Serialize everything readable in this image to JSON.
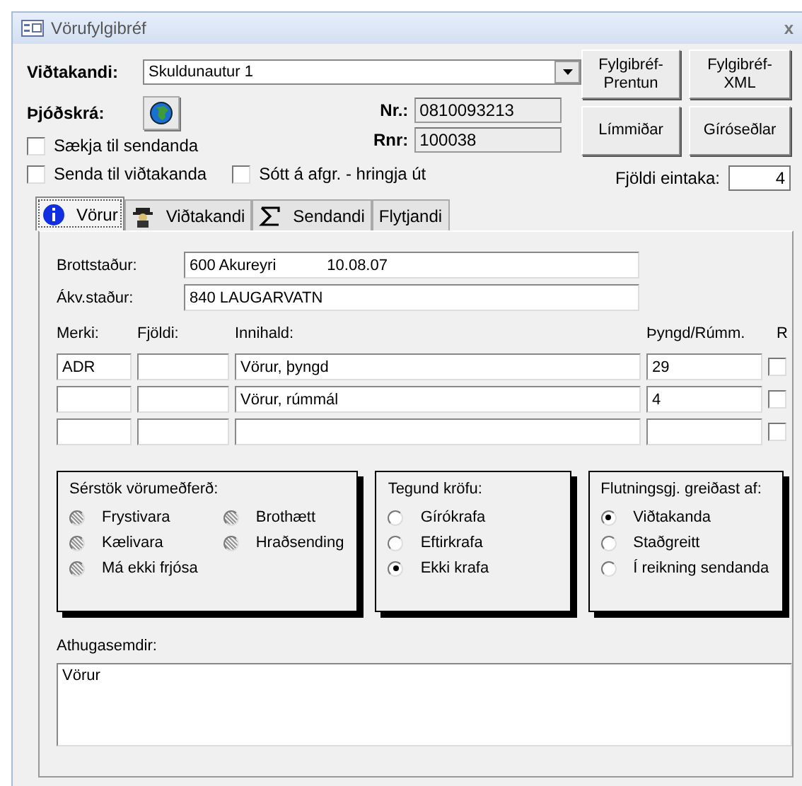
{
  "window": {
    "title": "Vörufylgibréf",
    "close": "x"
  },
  "recipient": {
    "label": "Viðtakandi:",
    "value": "Skuldunautur 1"
  },
  "registry": {
    "label": "Þjóðskrá:"
  },
  "nr": {
    "label": "Nr.:",
    "value": "0810093213"
  },
  "rnr": {
    "label": "Rnr:",
    "value": "100038"
  },
  "options": [
    {
      "label": "Sækja til sendanda",
      "checked": false
    },
    {
      "label": "Senda til viðtakanda",
      "checked": false
    },
    {
      "label": "Sótt á afgr. - hringja út",
      "checked": false
    }
  ],
  "buttons": [
    {
      "label": "Fylgibréf-Prentun"
    },
    {
      "label": "Fylgibréf-XML"
    },
    {
      "label": "Límmiðar"
    },
    {
      "label": "Gíróseðlar"
    }
  ],
  "copies": {
    "label": "Fjöldi eintaka:",
    "value": "4"
  },
  "tabs": [
    {
      "label": "Vörur",
      "kind": "info",
      "selected": true
    },
    {
      "label": "Viðtakandi",
      "kind": "person",
      "selected": false
    },
    {
      "label": "Sendandi",
      "kind": "sigma",
      "selected": false
    },
    {
      "label": "Flytjandi",
      "kind": "plain",
      "selected": false
    }
  ],
  "origin": {
    "label": "Brottstaður:",
    "place": "600 Akureyri",
    "date": "10.08.07"
  },
  "destination": {
    "label": "Ákv.staður:",
    "value": "840 LAUGARVATN"
  },
  "columns": [
    "Merki:",
    "Fjöldi:",
    "Innihald:",
    "Þyngd/Rúmm.",
    "R"
  ],
  "rows": [
    {
      "mark": "ADR",
      "count": "",
      "content": "Vörur, þyngd",
      "weight": "29",
      "r": false
    },
    {
      "mark": "",
      "count": "",
      "content": "Vörur, rúmmál",
      "weight": "4",
      "r": false
    },
    {
      "mark": "",
      "count": "",
      "content": "",
      "weight": "",
      "r": false
    }
  ],
  "handling": {
    "title": "Sérstök vörumeðferð:",
    "items": [
      {
        "label": "Frystivara",
        "disabled": true
      },
      {
        "label": "Kælivara",
        "disabled": true
      },
      {
        "label": "Má ekki frjósa",
        "disabled": true
      },
      {
        "label": "Brothætt",
        "disabled": true
      },
      {
        "label": "Hraðsending",
        "disabled": true
      }
    ]
  },
  "claim": {
    "title": "Tegund kröfu:",
    "items": [
      {
        "label": "Gírókrafa",
        "selected": false
      },
      {
        "label": "Eftirkrafa",
        "selected": false
      },
      {
        "label": "Ekki krafa",
        "selected": true
      }
    ]
  },
  "payer": {
    "title": "Flutningsgj. greiðast af:",
    "items": [
      {
        "label": "Viðtakanda",
        "selected": true
      },
      {
        "label": "Staðgreitt",
        "selected": false
      },
      {
        "label": "Í reikning sendanda",
        "selected": false
      }
    ]
  },
  "remarks": {
    "label": "Athugasemdir:",
    "value": "Vörur"
  }
}
